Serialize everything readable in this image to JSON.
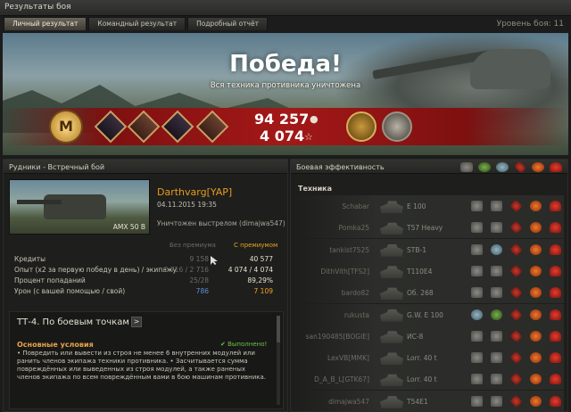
{
  "window": {
    "title": "Результаты боя",
    "battle_level": "Уровень боя: 11"
  },
  "tabs": [
    {
      "label": "Личный результат",
      "active": true
    },
    {
      "label": "Командный результат",
      "active": false
    },
    {
      "label": "Подробный отчёт",
      "active": false
    }
  ],
  "banner": {
    "result": "Победа!",
    "subtitle": "Вся техника противника уничтожена",
    "mastery_letter": "M",
    "credits": "94 257",
    "experience": "4 074",
    "credits_icon": "coin-icon",
    "exp_icon": "star-icon"
  },
  "battle": {
    "map_mode": "Рудники - Встречный бой"
  },
  "player": {
    "tank": "AMX 50 B",
    "name": "Darthvarg[YAP]",
    "date": "04.11.2015 19:35",
    "destroyed_by": "Уничтожен выстрелом (dimajwa547)"
  },
  "columns": {
    "no_premium": "Без премиума",
    "premium": "С премиумом"
  },
  "stats": [
    {
      "label": "Кредиты",
      "v1": "9 158",
      "v2": "40 577"
    },
    {
      "label": "Опыт  (х2 за первую победу в день) / экипажу",
      "v1": "2 716 / 2 716",
      "v2": "4 074 / 4 074"
    },
    {
      "label": "Процент попаданий",
      "v1": "25/28",
      "v2": "89,29%"
    },
    {
      "label": "Урон (с вашей помощью / свой)",
      "v1": "786",
      "v2": "7 109"
    }
  ],
  "mission": {
    "title": "ТТ-4. По боевым точкам",
    "arrow": ">",
    "conditions_title": "Основные условия",
    "status": "✔ Выполнено!",
    "text": "• Повредить или вывести из строя не менее 6 внутренних модулей или ранить членов экипажа техники противника. • Засчитывается сумма повреждённых или выведенных из строя модулей, а также раненых членов экипажа по всем повреждённым вами в бою машинам противника."
  },
  "efficiency": {
    "header": "Боевая эффективность",
    "section": "Техника",
    "rows": [
      {
        "player": "Schabar",
        "tank": "E 100",
        "icons": [
          "grey",
          "grey",
          "red",
          "fire",
          "crit"
        ]
      },
      {
        "player": "Pomka25",
        "tank": "T57 Heavy",
        "icons": [
          "grey",
          "grey",
          "red",
          "fire",
          "crit"
        ]
      },
      {
        "player": "tankist7525",
        "tank": "STB-1",
        "icons": [
          "grey",
          "teal",
          "red",
          "fire",
          "crit"
        ]
      },
      {
        "player": "DithVith[TFS2]",
        "tank": "T110E4",
        "icons": [
          "grey",
          "grey",
          "red",
          "fire",
          "crit"
        ]
      },
      {
        "player": "bardo82",
        "tank": "Об. 268",
        "icons": [
          "grey",
          "grey",
          "red",
          "fire",
          "crit"
        ]
      },
      {
        "player": "rukusta",
        "tank": "G.W. E 100",
        "icons": [
          "teal",
          "green",
          "red",
          "fire",
          "crit"
        ]
      },
      {
        "player": "san190485[BOGIE]",
        "tank": "ИС-8",
        "icons": [
          "grey",
          "grey",
          "red",
          "fire",
          "crit"
        ]
      },
      {
        "player": "LexVB[MMK]",
        "tank": "Lorr. 40 t",
        "icons": [
          "grey",
          "grey",
          "red",
          "fire",
          "crit"
        ]
      },
      {
        "player": "D_A_B_L[GTK67]",
        "tank": "Lorr. 40 t",
        "icons": [
          "grey",
          "grey",
          "red",
          "fire",
          "crit"
        ]
      },
      {
        "player": "dimajwa547",
        "tank": "T54E1",
        "icons": [
          "grey",
          "grey",
          "red",
          "fire",
          "crit"
        ]
      }
    ]
  }
}
